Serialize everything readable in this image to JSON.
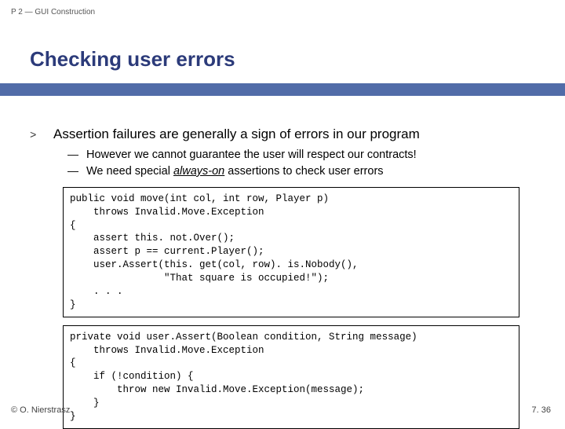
{
  "header": {
    "label": "P 2 — GUI Construction"
  },
  "title": "Checking user errors",
  "bullet": {
    "mark": ">",
    "text": "Assertion failures are generally a sign of errors  in our program"
  },
  "subBullets": [
    {
      "mark": "—",
      "text": "However we cannot guarantee the user will respect our contracts!"
    },
    {
      "mark": "—",
      "prefix": "We need special ",
      "emph": "always-on",
      "suffix": " assertions to check user errors"
    }
  ],
  "code1": "public void move(int col, int row, Player p)\n    throws Invalid.Move.Exception\n{\n    assert this. not.Over();\n    assert p == current.Player();\n    user.Assert(this. get(col, row). is.Nobody(),\n                \"That square is occupied!\");\n    . . .\n}",
  "code2": "private void user.Assert(Boolean condition, String message)\n    throws Invalid.Move.Exception\n{\n    if (!condition) {\n        throw new Invalid.Move.Exception(message);\n    }\n}",
  "footer": {
    "left": "© O. Nierstrasz",
    "right": "7. 36"
  }
}
